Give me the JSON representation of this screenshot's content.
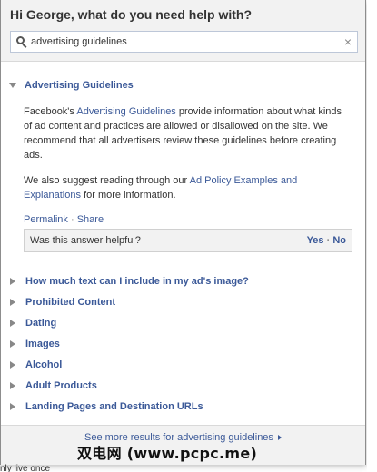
{
  "header": {
    "greeting": "Hi George, what do you need help with?",
    "search_value": "advertising guidelines",
    "clear_symbol": "×"
  },
  "article": {
    "title": "Advertising Guidelines",
    "para1_prefix": "Facebook's ",
    "para1_link": "Advertising Guidelines",
    "para1_suffix": " provide information about what kinds of ad content and practices are allowed or disallowed on the site. We recommend that all advertisers review these guidelines before creating ads.",
    "para2_prefix": "We also suggest reading through our ",
    "para2_link": "Ad Policy Examples and Explanations",
    "para2_suffix": " for more information.",
    "permalink": "Permalink",
    "separator": "·",
    "share": "Share",
    "helpful_question": "Was this answer helpful?",
    "yes": "Yes",
    "no": "No"
  },
  "faq_items": [
    "How much text can I include in my ad's image?",
    "Prohibited Content",
    "Dating",
    "Images",
    "Alcohol",
    "Adult Products",
    "Landing Pages and Destination URLs"
  ],
  "footer": {
    "see_more": "See more results for advertising guidelines"
  },
  "overlay": {
    "watermark": "双电网 (www.pcpc.me)",
    "peek_text": "nly live once"
  },
  "colors": {
    "link": "#3b5998",
    "header_bg": "#f2f2f2"
  },
  "icons": {
    "search": "magnifier-icon",
    "clear": "close-icon",
    "expanded": "triangle-down-icon",
    "collapsed": "triangle-right-icon"
  }
}
